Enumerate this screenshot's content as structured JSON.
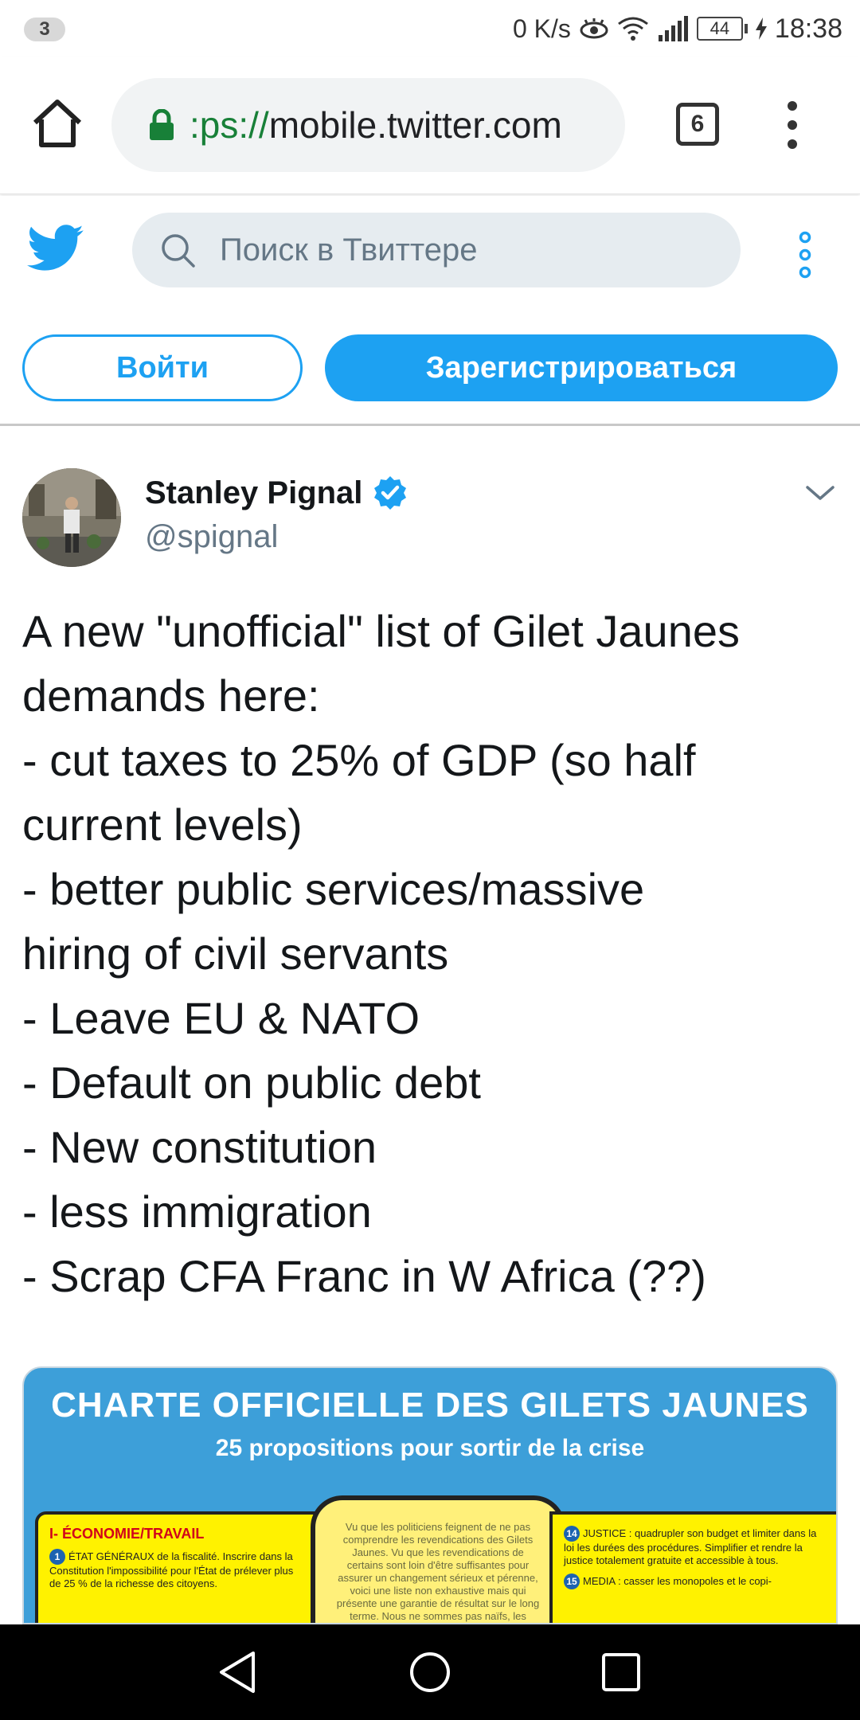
{
  "status_bar": {
    "notification_count": "3",
    "net_speed": "0 K/s",
    "battery": "44",
    "time": "18:38"
  },
  "browser": {
    "url_scheme": ":ps://",
    "url_host": "mobile.twitter.com",
    "tab_count": "6"
  },
  "twitter": {
    "search_placeholder": "Поиск в Твиттере",
    "login_label": "Войти",
    "signup_label": "Зарегистрироваться",
    "brand_color": "#1da1f2"
  },
  "tweet": {
    "author_name": "Stanley Pignal",
    "author_handle": "@spignal",
    "verified": true,
    "lines": [
      "A new \"unofficial\" list of Gilet Jaunes",
      "demands here:",
      "- cut taxes to 25% of GDP (so half",
      "current levels)",
      "- better public services/massive",
      "hiring of civil servants",
      "- Leave EU & NATO",
      "- Default on public debt",
      "- New constitution",
      "- less immigration",
      "- Scrap CFA Franc in W Africa (??)"
    ],
    "media": {
      "title": "CHARTE OFFICIELLE DES GILETS JAUNES",
      "subtitle": "25 propositions pour sortir de la crise",
      "left_section": "I- ÉCONOMIE/TRAVAIL",
      "left_item_num": "1",
      "left_item_text": "ÉTAT GÉNÉRAUX de la fiscalité. Inscrire dans la Constitution l'impossibilité pour l'État de prélever plus de 25 % de la richesse des citoyens.",
      "center_text": "Vu que les politiciens feignent de ne pas comprendre les revendications des Gilets Jaunes. Vu que les revendications de certains sont loin d'être suffisantes pour assurer un changement sérieux et pérenne, voici une liste non exhaustive mais qui présente une garantie de résultat sur le long terme. Nous ne sommes pas naïfs, les",
      "right_item_num": "14",
      "right_item_text": "JUSTICE : quadrupler son budget et limiter dans la loi les durées des procédures. Simplifier et rendre la justice totalement gratuite et accessible à tous.",
      "right_item2_num": "15",
      "right_item2_text": "MEDIA : casser les monopoles et le copi-"
    }
  }
}
